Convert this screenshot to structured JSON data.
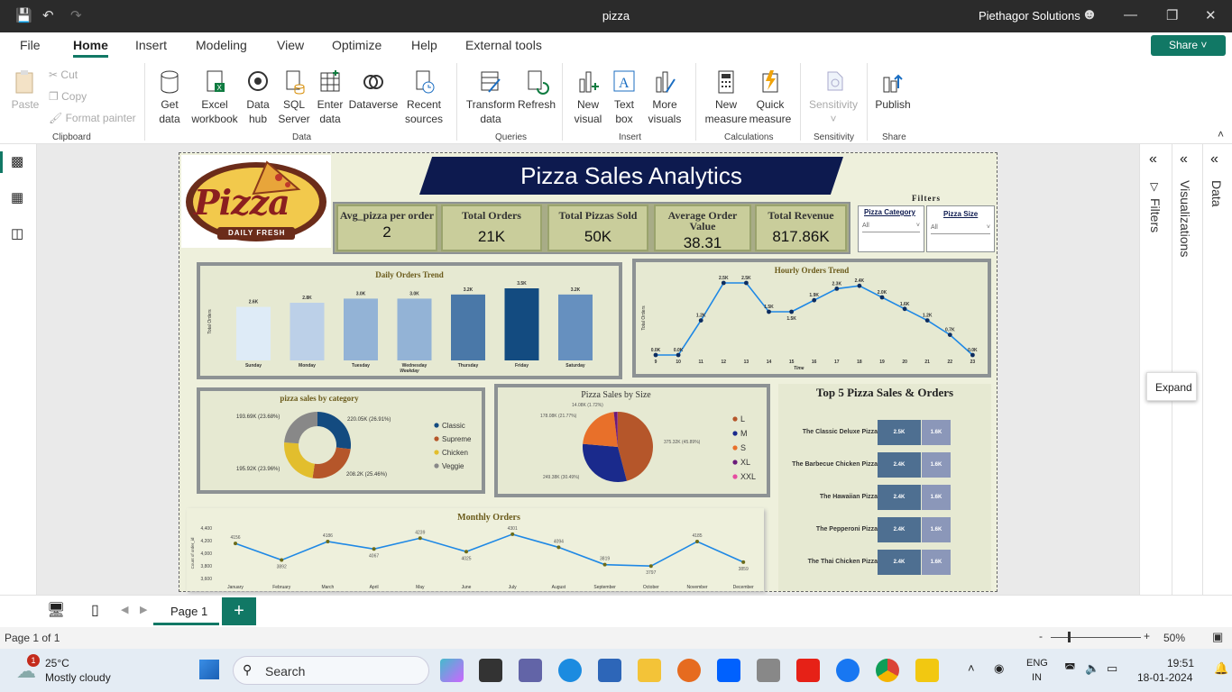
{
  "window": {
    "title": "pizza",
    "account": "Piethagor Solutions"
  },
  "tabs": [
    "File",
    "Home",
    "Insert",
    "Modeling",
    "View",
    "Optimize",
    "Help",
    "External tools"
  ],
  "share_label": "Share",
  "ribbon": {
    "clipboard": {
      "paste": "Paste",
      "cut": "Cut",
      "copy": "Copy",
      "format_painter": "Format painter",
      "group": "Clipboard"
    },
    "data": {
      "get_data": "Get data",
      "excel": "Excel workbook",
      "data_hub": "Data hub",
      "sql": "SQL Server",
      "enter": "Enter data",
      "dataverse": "Dataverse",
      "recent": "Recent sources",
      "group": "Data"
    },
    "queries": {
      "transform": "Transform data",
      "refresh": "Refresh",
      "group": "Queries"
    },
    "insert": {
      "new_visual": "New visual",
      "text_box": "Text box",
      "more_visuals": "More visuals",
      "group": "Insert"
    },
    "calc": {
      "new_measure": "New measure",
      "quick_measure": "Quick measure",
      "group": "Calculations"
    },
    "sensitivity": {
      "label": "Sensitivity",
      "group": "Sensitivity"
    },
    "share": {
      "publish": "Publish",
      "group": "Share"
    }
  },
  "report": {
    "title": "Pizza Sales Analytics",
    "logo_text": "Pizza",
    "logo_sub": "DAILY FRESH",
    "cards": [
      {
        "label": "Avg_pizza per order",
        "value": "2"
      },
      {
        "label": "Total Orders",
        "value": "21K"
      },
      {
        "label": "Total Pizzas Sold",
        "value": "50K"
      },
      {
        "label": "Average Order Value",
        "value": "38.31"
      },
      {
        "label": "Total Revenue",
        "value": "817.86K"
      }
    ],
    "filters": {
      "title": "Filters",
      "category_label": "Pizza Category",
      "size_label": "Pizza Size",
      "category_value": "All",
      "size_value": "All"
    }
  },
  "chart_data": [
    {
      "type": "bar",
      "title": "Daily Orders Trend",
      "xlabel": "Weekday",
      "ylabel": "Total Orders",
      "categories": [
        "Sunday",
        "Monday",
        "Tuesday",
        "Wednesday",
        "Thursday",
        "Friday",
        "Saturday"
      ],
      "values": [
        2.6,
        2.8,
        3.0,
        3.0,
        3.2,
        3.5,
        3.2
      ],
      "labels": [
        "2.6K",
        "2.8K",
        "3.0K",
        "3.0K",
        "3.2K",
        "3.5K",
        "3.2K"
      ],
      "colors": [
        "#deebf7",
        "#bcd0e8",
        "#93b3d6",
        "#93b3d6",
        "#4a78a8",
        "#134b80",
        "#6690bf"
      ],
      "ylim": [
        0,
        3.5
      ]
    },
    {
      "type": "line",
      "title": "Hourly Orders Trend",
      "xlabel": "Time",
      "ylabel": "Total Orders",
      "x": [
        9,
        10,
        11,
        12,
        13,
        14,
        15,
        16,
        17,
        18,
        19,
        20,
        21,
        22,
        23
      ],
      "values": [
        0.0,
        0.0,
        1.2,
        2.5,
        2.5,
        1.5,
        1.5,
        1.9,
        2.3,
        2.4,
        2.0,
        1.6,
        1.2,
        0.7,
        0.0
      ],
      "labels": [
        "0.0K",
        "0.0K",
        "1.2K",
        "2.5K",
        "2.5K",
        "1.5K",
        "1.5K",
        "1.9K",
        "2.3K",
        "2.4K",
        "2.0K",
        "1.6K",
        "1.2K",
        "0.7K",
        "0.0K"
      ],
      "ylim": [
        0,
        2.5
      ]
    },
    {
      "type": "pie",
      "title": "pizza sales by category",
      "categories": [
        "Classic",
        "Supreme",
        "Chicken",
        "Veggie"
      ],
      "values": [
        220.05,
        208.2,
        195.92,
        193.69
      ],
      "labels": [
        "220.05K (26.91%)",
        "208.2K (25.46%)",
        "195.92K (23.96%)",
        "193.69K (23.68%)"
      ],
      "colors": [
        "#134b80",
        "#b5562a",
        "#e2be2d",
        "#888888"
      ]
    },
    {
      "type": "pie",
      "title": "Pizza Sales by Size",
      "categories": [
        "L",
        "M",
        "S",
        "XL",
        "XXL"
      ],
      "values": [
        375.32,
        249.38,
        178.08,
        14.08,
        1.0
      ],
      "labels": [
        "375.32K (45.89%)",
        "249.38K (30.49%)",
        "178.08K (21.77%)",
        "14.08K (1.72%)",
        ""
      ],
      "colors": [
        "#b5562a",
        "#1a2a8c",
        "#e8702a",
        "#6a1b7a",
        "#e64ca0"
      ]
    },
    {
      "type": "line",
      "title": "Monthly Orders",
      "ylabel": "Count of order_id",
      "categories": [
        "January",
        "February",
        "March",
        "April",
        "May",
        "June",
        "July",
        "August",
        "September",
        "October",
        "November",
        "December"
      ],
      "values": [
        4156,
        3892,
        4186,
        4067,
        4239,
        4025,
        4301,
        4094,
        3819,
        3797,
        4185,
        3859
      ],
      "yticks": [
        "4,400",
        "4,200",
        "4,000",
        "3,800",
        "3,600"
      ],
      "ylim": [
        3600,
        4400
      ]
    },
    {
      "type": "table",
      "title": "Top 5 Pizza Sales & Orders",
      "rows": [
        "The Classic Deluxe Pizza",
        "The Barbecue Chicken Pizza",
        "The Hawaiian Pizza",
        "The Pepperoni Pizza",
        "The Thai Chicken Pizza"
      ],
      "sales": [
        "2.5K",
        "2.4K",
        "2.4K",
        "2.4K",
        "2.4K"
      ],
      "orders": [
        "1.6K",
        "1.6K",
        "1.6K",
        "1.6K",
        "1.6K"
      ]
    }
  ],
  "panes": {
    "filters": "Filters",
    "visualizations": "Visualizations",
    "data": "Data",
    "expand_tooltip": "Expand"
  },
  "pages": {
    "page1": "Page 1",
    "status": "Page 1 of 1",
    "zoom": "50%"
  },
  "taskbar": {
    "temp": "25°C",
    "weather": "Mostly cloudy",
    "search": "Search",
    "lang1": "ENG",
    "lang2": "IN",
    "time": "19:51",
    "date": "18-01-2024",
    "badge": "1"
  }
}
